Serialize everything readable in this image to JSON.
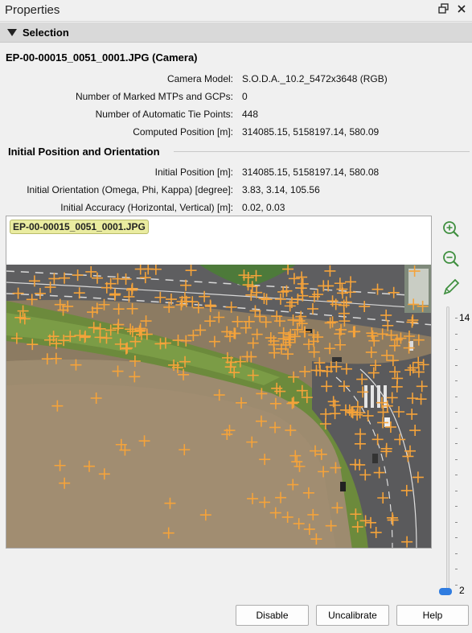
{
  "window": {
    "title": "Properties",
    "restore_icon": "restore-icon",
    "close_icon": "close-icon"
  },
  "section": {
    "label": "Selection"
  },
  "camera": {
    "title": "EP-00-00015_0051_0001.JPG (Camera)",
    "fields": [
      {
        "label": "Camera Model:",
        "value": "S.O.D.A._10.2_5472x3648 (RGB)"
      },
      {
        "label": "Number of Marked MTPs and GCPs:",
        "value": "0"
      },
      {
        "label": "Number of Automatic Tie Points:",
        "value": "448"
      },
      {
        "label": "Computed Position [m]:",
        "value": "314085.15, 5158197.14, 580.09"
      }
    ]
  },
  "initial": {
    "heading": "Initial Position and Orientation",
    "fields": [
      {
        "label": "Initial Position [m]:",
        "value": "314085.15, 5158197.14, 580.08"
      },
      {
        "label": "Initial Orientation (Omega, Phi, Kappa) [degree]:",
        "value": "3.83, 3.14, 105.56"
      },
      {
        "label": "Initial Accuracy (Horizontal, Vertical) [m]:",
        "value": "0.02, 0.03"
      }
    ]
  },
  "viewer": {
    "image_label": "EP-00-00015_0051_0001.JPG",
    "tie_point_color": "#f5a33a"
  },
  "tools": [
    "zoom-in-icon",
    "zoom-out-icon",
    "pencil-icon"
  ],
  "slider": {
    "max_label": "14",
    "min_label": "2",
    "value": 2
  },
  "buttons": {
    "disable": "Disable",
    "uncalibrate": "Uncalibrate",
    "help": "Help"
  }
}
